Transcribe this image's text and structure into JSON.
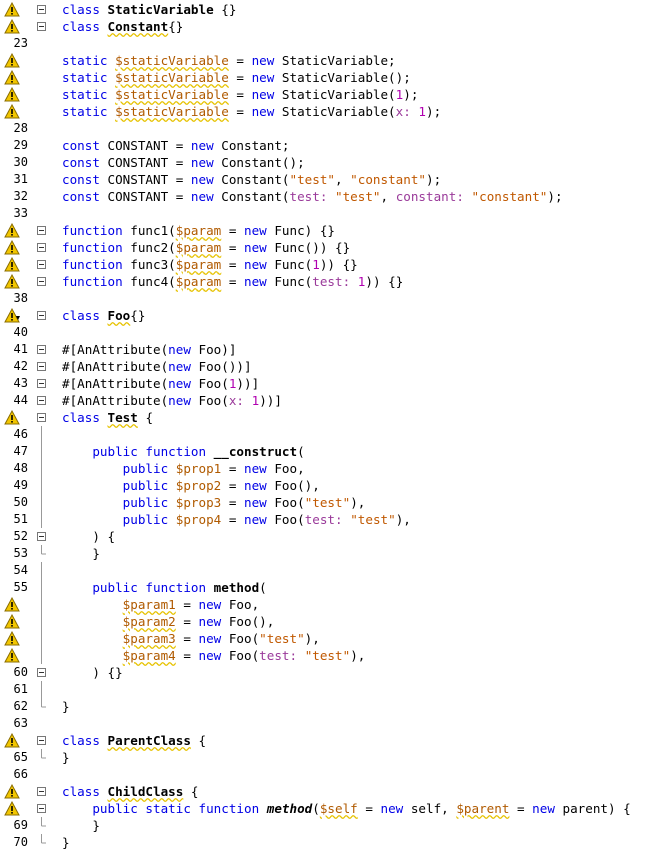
{
  "editor": {
    "lines": [
      {
        "n": "",
        "warn": true,
        "fold": "box",
        "html": "<span class='kw'>class</span> <span class='cls'>StaticVariable</span> {}"
      },
      {
        "n": "",
        "warn": true,
        "fold": "box",
        "html": "<span class='kw'>class</span> <span class='cls ul'>Constant</span>{}"
      },
      {
        "n": "23",
        "warn": false,
        "fold": "",
        "html": ""
      },
      {
        "n": "",
        "warn": true,
        "fold": "",
        "html": "<span class='kw'>static</span> <span class='var ul'>$staticVariable</span> = <span class='kw'>new</span> StaticVariable;"
      },
      {
        "n": "",
        "warn": true,
        "fold": "",
        "html": "<span class='kw'>static</span> <span class='var ul'>$staticVariable</span> = <span class='kw'>new</span> StaticVariable();"
      },
      {
        "n": "",
        "warn": true,
        "fold": "",
        "html": "<span class='kw'>static</span> <span class='var ul'>$staticVariable</span> = <span class='kw'>new</span> StaticVariable(<span class='num'>1</span>);"
      },
      {
        "n": "",
        "warn": true,
        "fold": "",
        "html": "<span class='kw'>static</span> <span class='var ul'>$staticVariable</span> = <span class='kw'>new</span> StaticVariable(<span class='named'>x:</span> <span class='num'>1</span>);"
      },
      {
        "n": "28",
        "warn": false,
        "fold": "",
        "html": ""
      },
      {
        "n": "29",
        "warn": false,
        "fold": "",
        "html": "<span class='kw'>const</span> CONSTANT = <span class='kw'>new</span> Constant;"
      },
      {
        "n": "30",
        "warn": false,
        "fold": "",
        "html": "<span class='kw'>const</span> CONSTANT = <span class='kw'>new</span> Constant();"
      },
      {
        "n": "31",
        "warn": false,
        "fold": "",
        "html": "<span class='kw'>const</span> CONSTANT = <span class='kw'>new</span> Constant(<span class='str'>\"test\"</span>, <span class='str'>\"constant\"</span>);"
      },
      {
        "n": "32",
        "warn": false,
        "fold": "",
        "html": "<span class='kw'>const</span> CONSTANT = <span class='kw'>new</span> Constant(<span class='named'>test:</span> <span class='str'>\"test\"</span>, <span class='named'>constant:</span> <span class='str'>\"constant\"</span>);"
      },
      {
        "n": "33",
        "warn": false,
        "fold": "",
        "html": ""
      },
      {
        "n": "",
        "warn": true,
        "fold": "box",
        "html": "<span class='kw'>function</span> func1(<span class='var ul'>$param</span> = <span class='kw'>new</span> Func) {}"
      },
      {
        "n": "",
        "warn": true,
        "fold": "box",
        "html": "<span class='kw'>function</span> func2(<span class='var ul'>$param</span> = <span class='kw'>new</span> Func()) {}"
      },
      {
        "n": "",
        "warn": true,
        "fold": "box",
        "html": "<span class='kw'>function</span> func3(<span class='var ul'>$param</span> = <span class='kw'>new</span> Func(<span class='num'>1</span>)) {}"
      },
      {
        "n": "",
        "warn": true,
        "fold": "box",
        "html": "<span class='kw'>function</span> func4(<span class='var ul'>$param</span> = <span class='kw'>new</span> Func(<span class='named'>test:</span> <span class='num'>1</span>)) {}"
      },
      {
        "n": "38",
        "warn": false,
        "fold": "",
        "html": ""
      },
      {
        "n": "",
        "warn": true,
        "warnArrow": true,
        "fold": "box",
        "html": "<span class='kw'>class</span> <span class='cls ul'>Foo</span>{}"
      },
      {
        "n": "40",
        "warn": false,
        "fold": "",
        "html": ""
      },
      {
        "n": "41",
        "warn": false,
        "fold": "box",
        "html": "#[AnAttribute(<span class='kw'>new</span> Foo)]"
      },
      {
        "n": "42",
        "warn": false,
        "fold": "box",
        "html": "#[AnAttribute(<span class='kw'>new</span> Foo())]"
      },
      {
        "n": "43",
        "warn": false,
        "fold": "box",
        "html": "#[AnAttribute(<span class='kw'>new</span> Foo(<span class='num'>1</span>))]"
      },
      {
        "n": "44",
        "warn": false,
        "fold": "box",
        "html": "#[AnAttribute(<span class='kw'>new</span> Foo(<span class='named'>x:</span> <span class='num'>1</span>))]"
      },
      {
        "n": "",
        "warn": true,
        "fold": "box",
        "html": "<span class='kw'>class</span> <span class='cls ul'>Test</span> {"
      },
      {
        "n": "46",
        "warn": false,
        "fold": "line",
        "html": ""
      },
      {
        "n": "47",
        "warn": false,
        "fold": "line",
        "html": "    <span class='kw'>public function</span> <span class='cls'>__construct</span>("
      },
      {
        "n": "48",
        "warn": false,
        "fold": "line",
        "html": "        <span class='kw'>public</span> <span class='var'>$prop1</span> = <span class='kw'>new</span> Foo,"
      },
      {
        "n": "49",
        "warn": false,
        "fold": "line",
        "html": "        <span class='kw'>public</span> <span class='var'>$prop2</span> = <span class='kw'>new</span> Foo(),"
      },
      {
        "n": "50",
        "warn": false,
        "fold": "line",
        "html": "        <span class='kw'>public</span> <span class='var'>$prop3</span> = <span class='kw'>new</span> Foo(<span class='str'>\"test\"</span>),"
      },
      {
        "n": "51",
        "warn": false,
        "fold": "line",
        "html": "        <span class='kw'>public</span> <span class='var'>$prop4</span> = <span class='kw'>new</span> Foo(<span class='named'>test:</span> <span class='str'>\"test\"</span>),"
      },
      {
        "n": "52",
        "warn": false,
        "fold": "box",
        "html": "    ) {"
      },
      {
        "n": "53",
        "warn": false,
        "fold": "end",
        "html": "    }"
      },
      {
        "n": "54",
        "warn": false,
        "fold": "line",
        "html": ""
      },
      {
        "n": "55",
        "warn": false,
        "fold": "line",
        "html": "    <span class='kw'>public function</span> <span class='cls'>method</span>("
      },
      {
        "n": "",
        "warn": true,
        "fold": "line",
        "html": "        <span class='var ul'>$param1</span> = <span class='kw'>new</span> Foo,"
      },
      {
        "n": "",
        "warn": true,
        "fold": "line",
        "html": "        <span class='var ul'>$param2</span> = <span class='kw'>new</span> Foo(),"
      },
      {
        "n": "",
        "warn": true,
        "fold": "line",
        "html": "        <span class='var ul'>$param3</span> = <span class='kw'>new</span> Foo(<span class='str'>\"test\"</span>),"
      },
      {
        "n": "",
        "warn": true,
        "fold": "line",
        "html": "        <span class='var ul'>$param4</span> = <span class='kw'>new</span> Foo(<span class='named'>test:</span> <span class='str'>\"test\"</span>),"
      },
      {
        "n": "60",
        "warn": false,
        "fold": "box",
        "html": "    ) {}"
      },
      {
        "n": "61",
        "warn": false,
        "fold": "line",
        "html": ""
      },
      {
        "n": "62",
        "warn": false,
        "fold": "end",
        "html": "}"
      },
      {
        "n": "63",
        "warn": false,
        "fold": "",
        "html": ""
      },
      {
        "n": "",
        "warn": true,
        "fold": "box",
        "html": "<span class='kw'>class</span> <span class='cls ul'>ParentClass</span> {"
      },
      {
        "n": "65",
        "warn": false,
        "fold": "end",
        "html": "}"
      },
      {
        "n": "66",
        "warn": false,
        "fold": "",
        "html": ""
      },
      {
        "n": "",
        "warn": true,
        "fold": "box",
        "html": "<span class='kw'>class</span> <span class='cls ul'>ChildClass</span> {"
      },
      {
        "n": "",
        "warn": true,
        "fold": "box",
        "html": "    <span class='kw'>public static function</span> <span class='ital'>method</span>(<span class='var ul'>$self</span> = <span class='kw'>new</span> self, <span class='var ul'>$parent</span> = <span class='kw'>new</span> parent) {"
      },
      {
        "n": "69",
        "warn": false,
        "fold": "end",
        "html": "    }"
      },
      {
        "n": "70",
        "warn": false,
        "fold": "end",
        "html": "}"
      }
    ]
  }
}
